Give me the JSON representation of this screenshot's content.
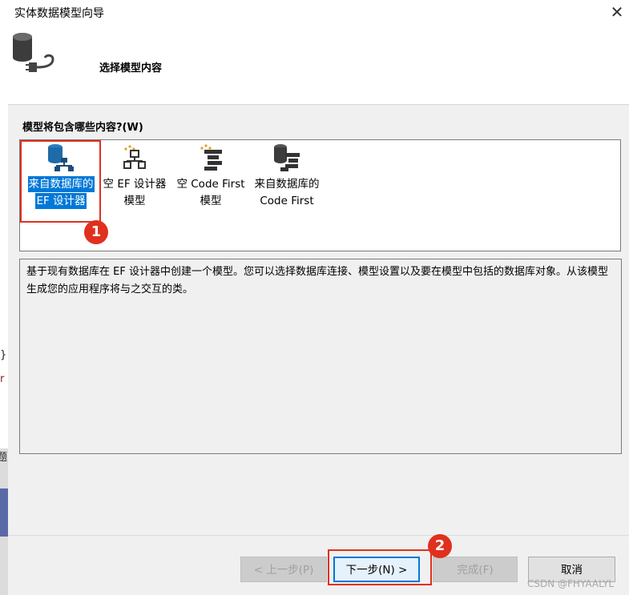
{
  "window": {
    "title": "实体数据模型向导",
    "close_glyph": "✕"
  },
  "header": {
    "subtitle": "选择模型内容",
    "icon": "database-plug-icon"
  },
  "prompt": "模型将包含哪些内容?(W)",
  "options": [
    {
      "line1": "来自数据库的",
      "line2": "EF 设计器",
      "icon": "database-hierarchy-icon",
      "selected": true
    },
    {
      "line1": "空 EF 设计器",
      "line2": "模型",
      "icon": "empty-hierarchy-icon",
      "selected": false
    },
    {
      "line1": "空 Code First",
      "line2": "模型",
      "icon": "empty-code-first-icon",
      "selected": false
    },
    {
      "line1": "来自数据库的",
      "line2": "Code First",
      "icon": "database-code-first-icon",
      "selected": false
    }
  ],
  "description": "基于现有数据库在 EF 设计器中创建一个模型。您可以选择数据库连接、模型设置以及要在模型中包括的数据库对象。从该模型生成您的应用程序将与之交互的类。",
  "annotations": {
    "badge1": "1",
    "badge2": "2"
  },
  "buttons": {
    "prev": "< 上一步(P)",
    "next": "下一步(N) >",
    "finish": "完成(F)",
    "cancel": "取消"
  },
  "watermark": "CSDN @FHYAALYL",
  "background_fragments": {
    "c1": "}",
    "c2": "r",
    "c3": "题"
  },
  "colors": {
    "selection": "#0078d7",
    "annotation_red": "#e0301e"
  }
}
